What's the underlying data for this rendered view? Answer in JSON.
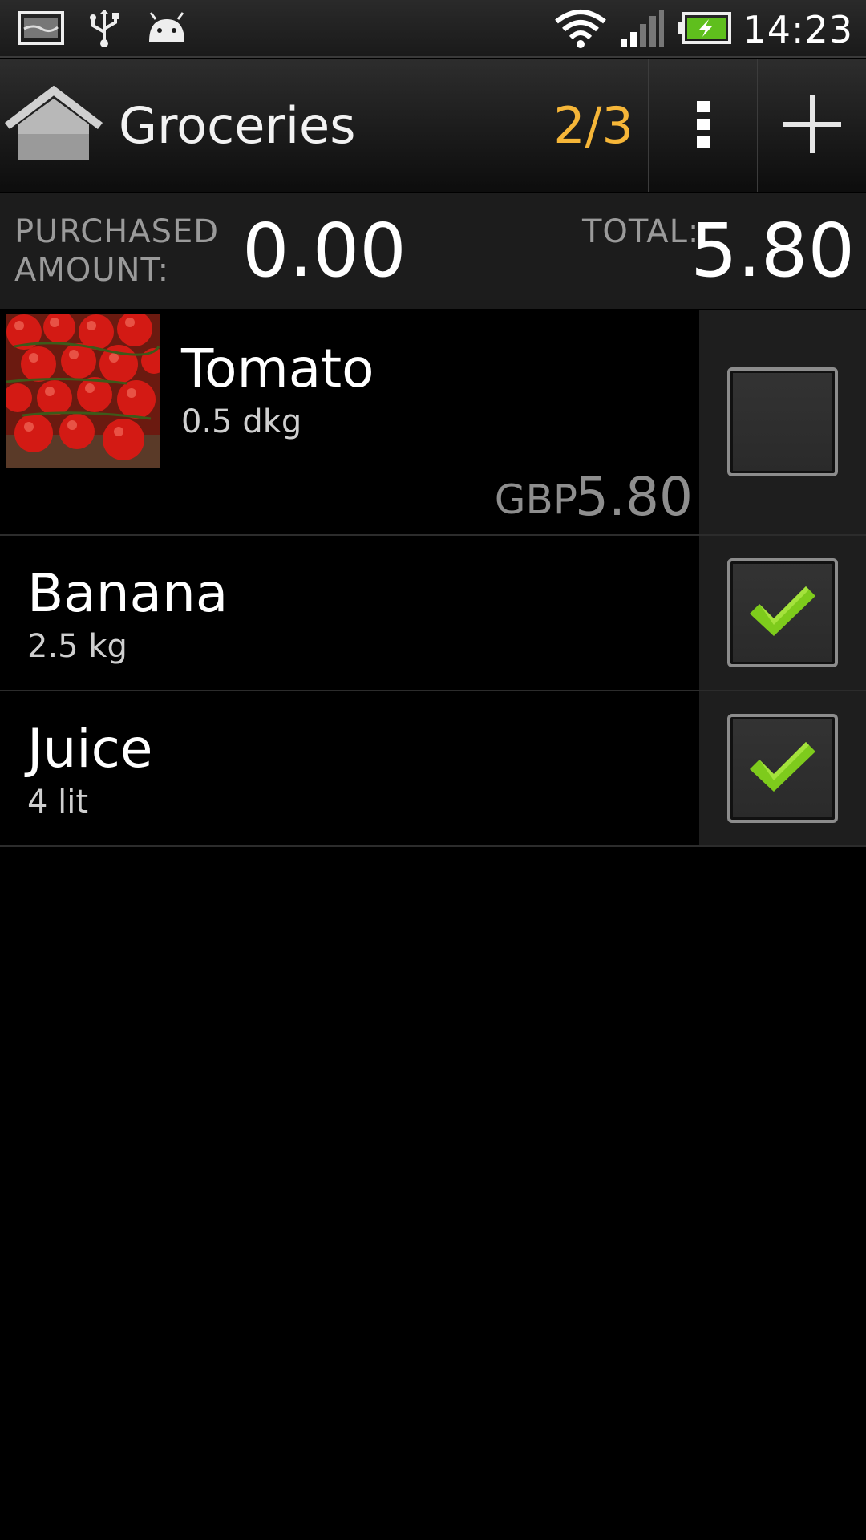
{
  "status_bar": {
    "time": "14:23",
    "icons": [
      "gallery-notification-icon",
      "usb-icon",
      "android-debug-icon",
      "wifi-icon",
      "signal-icon",
      "battery-charging-icon"
    ]
  },
  "action_bar": {
    "title": "Groceries",
    "count": "2/3",
    "accent_color": "#f6b638",
    "icons": [
      "home-icon",
      "overflow-menu-icon",
      "add-icon"
    ]
  },
  "summary": {
    "purchased_label_line1": "PURCHASED",
    "purchased_label_line2": "AMOUNT:",
    "purchased_value": "0.00",
    "total_label": "TOTAL:",
    "total_value": "5.80"
  },
  "items": [
    {
      "name": "Tomato",
      "quantity": "0.5 dkg",
      "currency": "GBP",
      "price": "5.80",
      "checked": false,
      "has_image": true
    },
    {
      "name": "Banana",
      "quantity": "2.5 kg",
      "checked": true,
      "has_image": false
    },
    {
      "name": "Juice",
      "quantity": "4 lit",
      "checked": true,
      "has_image": false
    }
  ],
  "check_color": "#7ecb1c"
}
